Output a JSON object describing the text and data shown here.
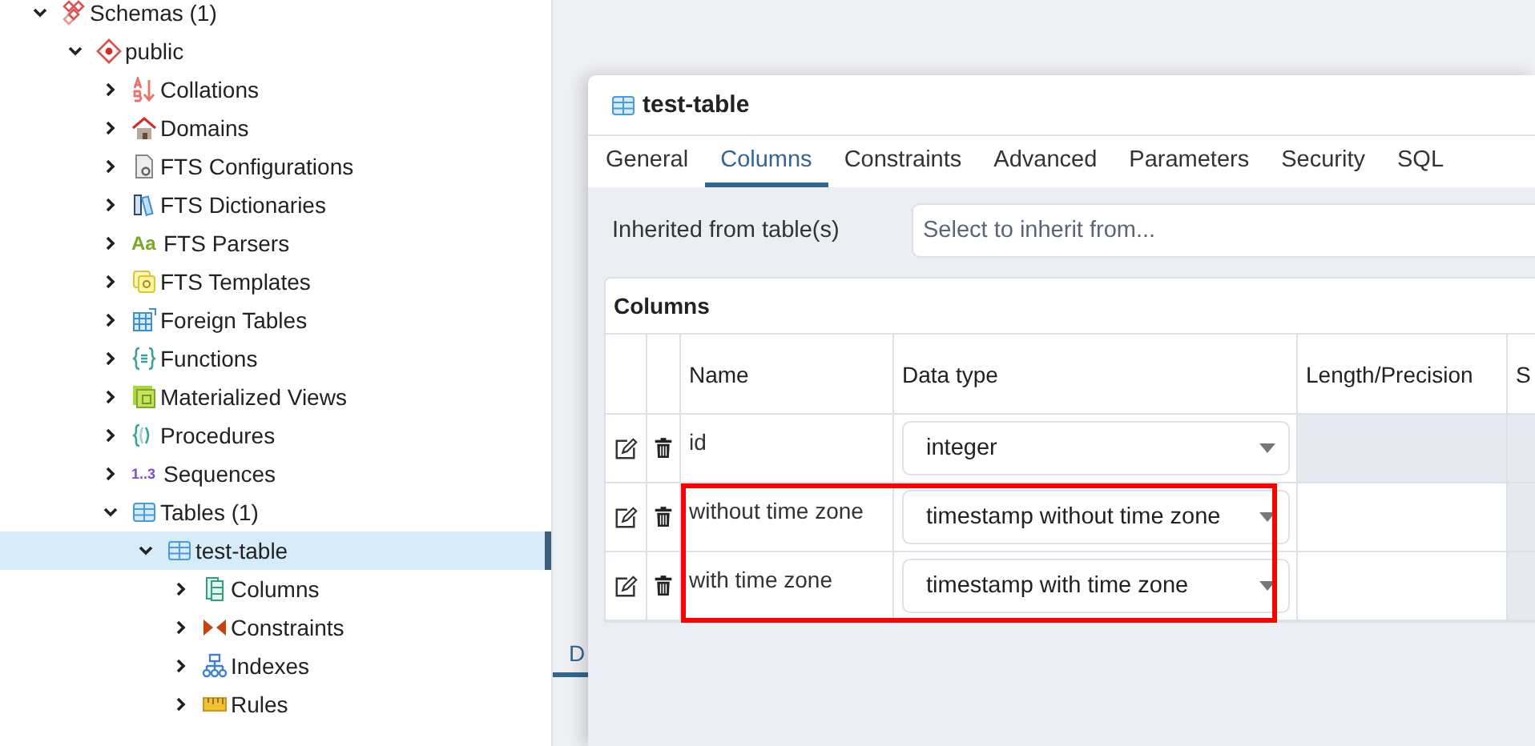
{
  "tree": [
    {
      "label": "Schemas (1)",
      "kind": "schemas",
      "expanded": true,
      "selected": false,
      "children": [
        {
          "label": "public",
          "kind": "schema",
          "expanded": true,
          "selected": false,
          "children": [
            {
              "label": "Collations",
              "kind": "collation",
              "expanded": false,
              "selected": false
            },
            {
              "label": "Domains",
              "kind": "domain",
              "expanded": false,
              "selected": false
            },
            {
              "label": "FTS Configurations",
              "kind": "fts-config",
              "expanded": false,
              "selected": false
            },
            {
              "label": "FTS Dictionaries",
              "kind": "fts-dict",
              "expanded": false,
              "selected": false
            },
            {
              "label": "FTS Parsers",
              "kind": "glyph",
              "icon_text": "Aa",
              "expanded": false,
              "selected": false
            },
            {
              "label": "FTS Templates",
              "kind": "fts-template",
              "expanded": false,
              "selected": false
            },
            {
              "label": "Foreign Tables",
              "kind": "foreign-table",
              "expanded": false,
              "selected": false
            },
            {
              "label": "Functions",
              "kind": "function",
              "expanded": false,
              "selected": false
            },
            {
              "label": "Materialized Views",
              "kind": "matview",
              "expanded": false,
              "selected": false
            },
            {
              "label": "Procedures",
              "kind": "procedure",
              "expanded": false,
              "selected": false
            },
            {
              "label": "Sequences",
              "kind": "glyph-seq",
              "icon_text": "1..3",
              "expanded": false,
              "selected": false
            },
            {
              "label": "Tables (1)",
              "kind": "table",
              "expanded": true,
              "selected": false,
              "children": [
                {
                  "label": "test-table",
                  "kind": "table",
                  "expanded": true,
                  "selected": true,
                  "children": [
                    {
                      "label": "Columns",
                      "kind": "column",
                      "expanded": false,
                      "selected": false
                    },
                    {
                      "label": "Constraints",
                      "kind": "constraint",
                      "expanded": false,
                      "selected": false
                    },
                    {
                      "label": "Indexes",
                      "kind": "index",
                      "expanded": false,
                      "selected": false
                    },
                    {
                      "label": "Rules",
                      "kind": "rule",
                      "expanded": false,
                      "selected": false
                    }
                  ]
                }
              ]
            }
          ]
        }
      ]
    }
  ],
  "background_tabs": [
    {
      "label": "D",
      "selected": true
    }
  ],
  "dialog": {
    "title": "test-table",
    "tabs": [
      {
        "label": "General",
        "selected": false
      },
      {
        "label": "Columns",
        "selected": true
      },
      {
        "label": "Constraints",
        "selected": false
      },
      {
        "label": "Advanced",
        "selected": false
      },
      {
        "label": "Parameters",
        "selected": false
      },
      {
        "label": "Security",
        "selected": false
      },
      {
        "label": "SQL",
        "selected": false
      }
    ],
    "inherit": {
      "label": "Inherited from table(s)",
      "placeholder": "Select to inherit from..."
    },
    "columns_panel": {
      "title": "Columns",
      "headers": [
        "Name",
        "Data type",
        "Length/Precision",
        "S"
      ],
      "rows": [
        {
          "name": "id",
          "data_type": "integer",
          "length_disabled": true
        },
        {
          "name": "without time zone",
          "data_type": "timestamp without time zone",
          "length_disabled": false
        },
        {
          "name": "with time zone",
          "data_type": "timestamp with time zone",
          "length_disabled": false
        }
      ]
    },
    "annotation": {
      "kind": "rectangle",
      "color": "#ff0000"
    }
  }
}
